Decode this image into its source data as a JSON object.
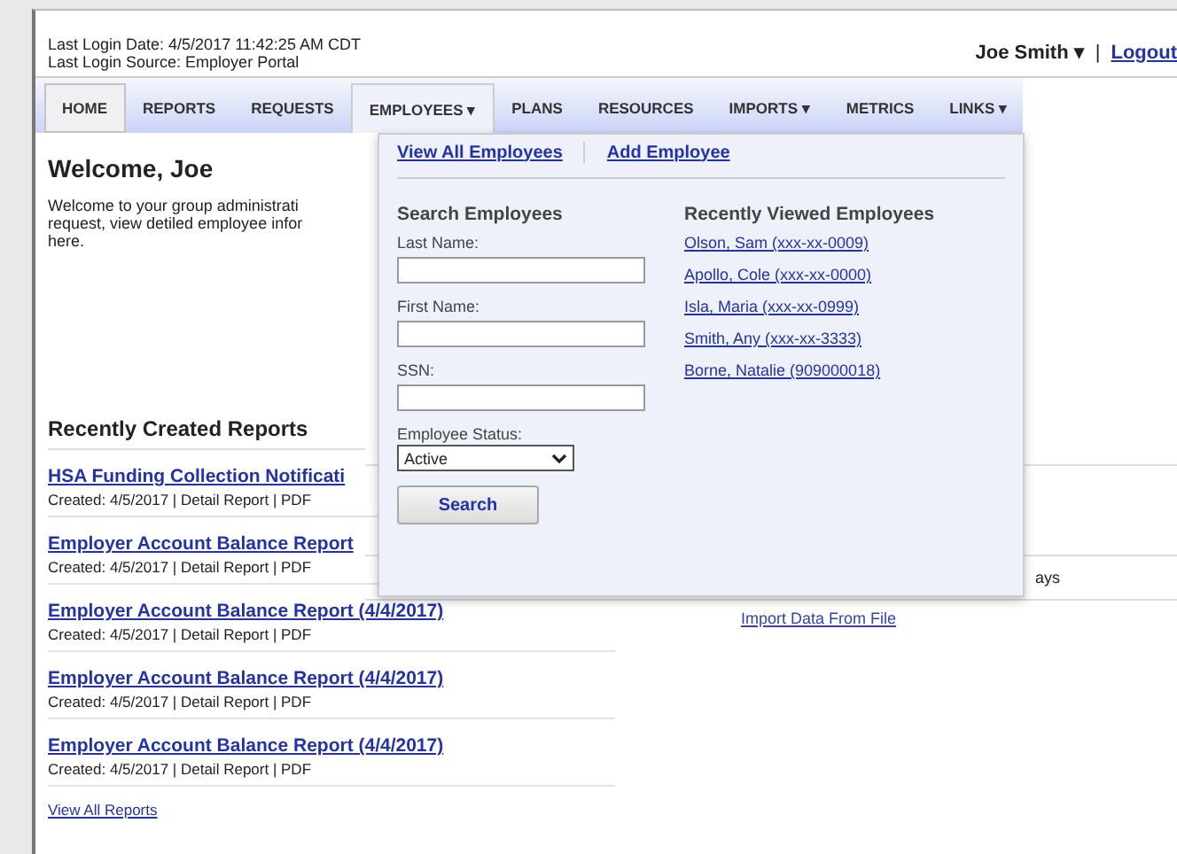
{
  "header": {
    "login_date": "Last Login Date: 4/5/2017 11:42:25 AM CDT",
    "login_source": "Last Login Source: Employer Portal",
    "user": "Joe Smith ▾",
    "separator": "|",
    "logout": "Logout"
  },
  "nav": [
    {
      "label": "HOME",
      "selected": true,
      "open": false
    },
    {
      "label": "REPORTS",
      "selected": false,
      "open": false
    },
    {
      "label": "REQUESTS",
      "selected": false,
      "open": false
    },
    {
      "label": "EMPLOYEES ▾",
      "selected": false,
      "open": true
    },
    {
      "label": "PLANS",
      "selected": false,
      "open": false
    },
    {
      "label": "RESOURCES",
      "selected": false,
      "open": false
    },
    {
      "label": "IMPORTS ▾",
      "selected": false,
      "open": false
    },
    {
      "label": "METRICS",
      "selected": false,
      "open": false
    },
    {
      "label": "LINKS ▾",
      "selected": false,
      "open": false
    }
  ],
  "welcome": {
    "title": "Welcome, Joe",
    "lines": [
      "Welcome to your group administrati",
      "request, view detiled employee infor",
      "here."
    ]
  },
  "reports": {
    "title": "Recently Created Reports",
    "items": [
      {
        "title": "HSA Funding Collection Notificati",
        "meta": "Created: 4/5/2017 | Detail Report | PDF"
      },
      {
        "title": "Employer Account Balance Report",
        "meta": "Created: 4/5/2017 | Detail Report | PDF"
      },
      {
        "title": "Employer Account Balance Report (4/4/2017)",
        "meta": "Created: 4/5/2017 | Detail Report | PDF"
      },
      {
        "title": "Employer Account Balance Report (4/4/2017)",
        "meta": "Created: 4/5/2017 | Detail Report | PDF"
      },
      {
        "title": "Employer Account Balance Report (4/4/2017)",
        "meta": "Created: 4/5/2017 | Detail Report | PDF"
      }
    ],
    "view_all": "View All Reports"
  },
  "side": {
    "fragment": "ays",
    "link": "Import Data From File"
  },
  "dropdown": {
    "links": [
      "View All Employees",
      "Add Employee"
    ],
    "search": {
      "title": "Search Employees",
      "fields": [
        {
          "label": "Last Name:",
          "kind": "text"
        },
        {
          "label": "First Name:",
          "kind": "text"
        },
        {
          "label": "SSN:",
          "kind": "text"
        },
        {
          "label": "Employee Status:",
          "kind": "select",
          "value": "Active"
        }
      ],
      "button": "Search"
    },
    "recent": {
      "title": "Recently Viewed Employees",
      "items": [
        "Olson, Sam (xxx-xx-0009)",
        "Apollo, Cole (xxx-xx-0000)",
        "Isla, Maria (xxx-xx-0999)",
        "Smith, Any (xxx-xx-3333)",
        "Borne, Natalie (909000018)"
      ]
    }
  }
}
